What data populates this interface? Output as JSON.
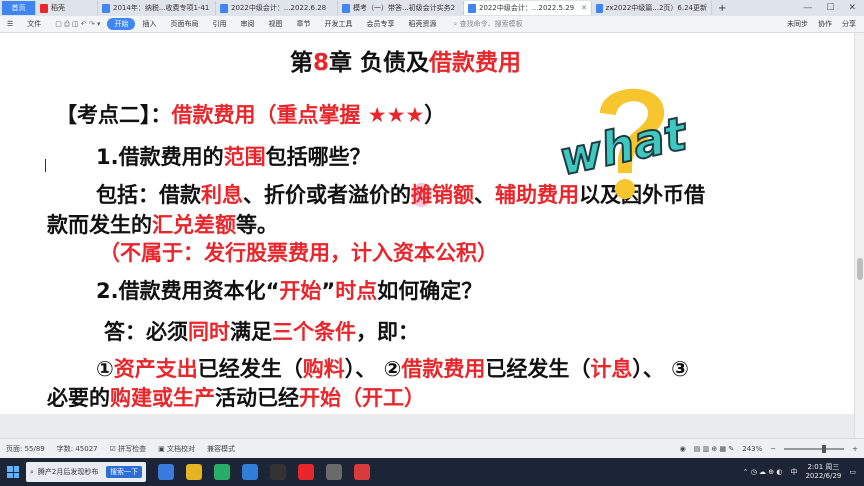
{
  "tabs": [
    {
      "label": "首页",
      "home": true
    },
    {
      "label": "稻壳",
      "color": "#e8262b"
    },
    {
      "label": "2014年：纳税...收费专项1-41",
      "color": "#3f86f2"
    },
    {
      "label": "2022中级会计：...2022.6.28",
      "color": "#3f86f2"
    },
    {
      "label": "模考（一）带答...初级会计实务2",
      "color": "#3f86f2"
    },
    {
      "label": "2022中级会计：...2022.5.29",
      "color": "#3f86f2",
      "active": true
    },
    {
      "label": "zx2022中级篇...2页）6.24更新",
      "color": "#3f86f2"
    }
  ],
  "ribbon": {
    "file": "文件",
    "start": "开始",
    "items": [
      "插入",
      "页面布局",
      "引用",
      "审阅",
      "视图",
      "章节",
      "开发工具",
      "会员专享",
      "稻壳资源"
    ],
    "search_placeholder": "查找命令、搜索模板",
    "right": [
      "未同步",
      "协作",
      "分享"
    ]
  },
  "document": {
    "title_a": "第",
    "title_num": "8",
    "title_b": "章  负债及",
    "title_red": "借款费用",
    "kp_a": "【考点二】：",
    "kp_red": "借款费用（重点掌握 ★★★",
    "kp_b": "）",
    "q1_a": "1.借款费用的",
    "q1_red": "范围",
    "q1_b": "包括哪些？",
    "p1_a": "包括：借款",
    "p1_r1": "利息",
    "p1_b": "、折价或者溢价的",
    "p1_r2a": "摊",
    "p1_r2b": "销额",
    "p1_c": "、",
    "p1_r3": "辅助费用",
    "p1_d": "以及因外币借",
    "p2_a": "款而发生的",
    "p2_red": "汇兑差额",
    "p2_b": "等。",
    "p3_red": "（不属于：发行股票费用，计入资本公积）",
    "q2_a": "2.借款费用资本化“",
    "q2_r1": "开始",
    "q2_b": "”",
    "q2_r2": "时点",
    "q2_c": "如何确定？",
    "ans_a": "答：必须",
    "ans_r1": "同时",
    "ans_b": "满足",
    "ans_r2": "三个条件",
    "ans_c": "，即：",
    "c1_a": "①",
    "c1_r1": "资产支出",
    "c1_b": "已经发生（",
    "c1_r2": "购料",
    "c1_c": "）、 ②",
    "c1_r3": "借款费用",
    "c1_d": "已经发生（",
    "c1_r4": "计息",
    "c1_e": "）、 ③",
    "c2_a": "必要的",
    "c2_r1": "购建或生产",
    "c2_b": "活动已经",
    "c2_r2": "开始（开工）",
    "logo_text": "what"
  },
  "status": {
    "page": "页面: 55/89",
    "words": "字数: 45027",
    "spell": "拼写检查",
    "proof": "文档校对",
    "compat": "兼容模式",
    "zoom": "243%"
  },
  "taskbar": {
    "item": "腾产2月后发现秒布",
    "search_btn": "搜索一下",
    "time": "2:01 周三",
    "date": "2022/6/29",
    "ime": "中"
  },
  "colors": {
    "red": "#e8262b",
    "accent": "#3f86f2",
    "logo_yellow": "#f7c62f",
    "logo_teal": "#3ec9c0"
  }
}
